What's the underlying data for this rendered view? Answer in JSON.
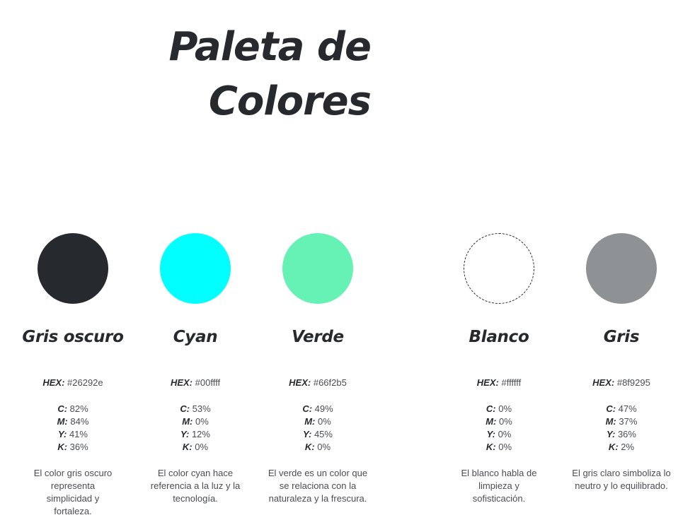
{
  "title": {
    "line1": "Paleta de",
    "line2": "Colores"
  },
  "labels": {
    "hex": "HEX:",
    "c": "C:",
    "m": "M:",
    "y": "Y:",
    "k": "K:"
  },
  "colors": [
    {
      "name": "Gris oscuro",
      "hex": "#26292e",
      "c": "82%",
      "m": "84%",
      "y": "41%",
      "k": "36%",
      "description": "El color gris oscuro representa simplicidad y fortaleza.",
      "swatch": "#26292e"
    },
    {
      "name": "Cyan",
      "hex": "#00ffff",
      "c": "53%",
      "m": "0%",
      "y": "12%",
      "k": "0%",
      "description": "El color cyan hace referencia a la luz y la tecnología.",
      "swatch": "#00ffff"
    },
    {
      "name": "Verde",
      "hex": "#66f2b5",
      "c": "49%",
      "m": "0%",
      "y": "45%",
      "k": "0%",
      "description": "El verde es un color que se relaciona con la naturaleza y la frescura.",
      "swatch": "#66f2b5"
    },
    {
      "name": "Blanco",
      "hex": "#ffffff",
      "c": "0%",
      "m": "0%",
      "y": "0%",
      "k": "0%",
      "description": "El blanco habla de limpieza y sofisticación.",
      "swatch": "#ffffff"
    },
    {
      "name": "Gris",
      "hex": "#8f9295",
      "c": "47%",
      "m": "37%",
      "y": "36%",
      "k": "2%",
      "description": "El gris claro simboliza lo neutro y lo equilibrado.",
      "swatch": "#8f9295"
    }
  ]
}
